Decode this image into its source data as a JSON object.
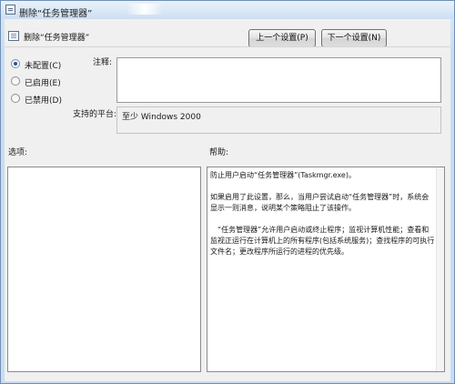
{
  "window": {
    "title": "删除“任务管理器”"
  },
  "header": {
    "title": "删除“任务管理器”",
    "prev_label": "上一个设置(P)",
    "next_label": "下一个设置(N)"
  },
  "state": {
    "options": [
      {
        "label": "未配置(C)",
        "selected": true
      },
      {
        "label": "已启用(E)",
        "selected": false
      },
      {
        "label": "已禁用(D)",
        "selected": false
      }
    ]
  },
  "comment": {
    "label": "注释:",
    "value": ""
  },
  "platform": {
    "label": "支持的平台:",
    "value": "至少 Windows 2000"
  },
  "options_section": {
    "label": "选项:"
  },
  "help_section": {
    "label": "帮助:",
    "paragraphs": [
      "防止用户启动“任务管理器”(Taskmgr.exe)。",
      "如果启用了此设置，那么，当用户尝试启动“任务管理器”时，系统会显示一则消息，说明某个策略阻止了该操作。",
      "“任务管理器”允许用户启动或终止程序；监视计算机性能；查看和监视正运行在计算机上的所有程序(包括系统服务)；查找程序的可执行文件名；更改程序所运行的进程的优先级。"
    ]
  }
}
